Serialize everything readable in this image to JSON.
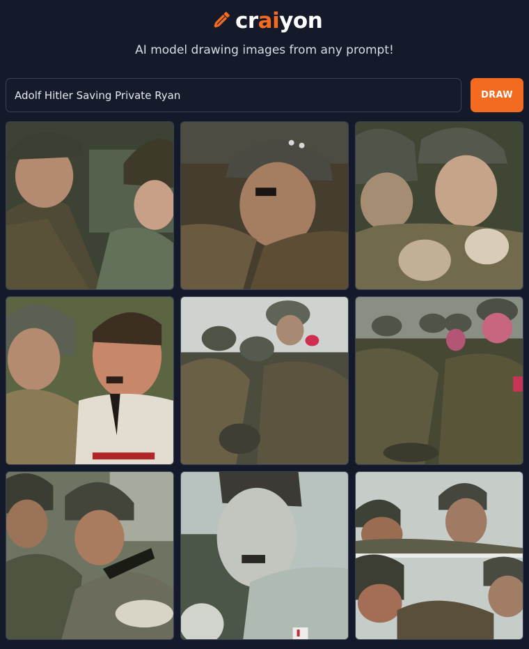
{
  "brand": {
    "logo_icon": "pencil-icon",
    "name_prefix": "cr",
    "name_accent": "ai",
    "name_suffix": "yon",
    "accent_color": "#f26b21"
  },
  "tagline": "AI model drawing images from any prompt!",
  "prompt": {
    "value": "Adolf Hitler Saving Private Ryan",
    "placeholder": ""
  },
  "draw_button": {
    "label": "DRAW"
  },
  "gallery": {
    "image_count": 9
  }
}
